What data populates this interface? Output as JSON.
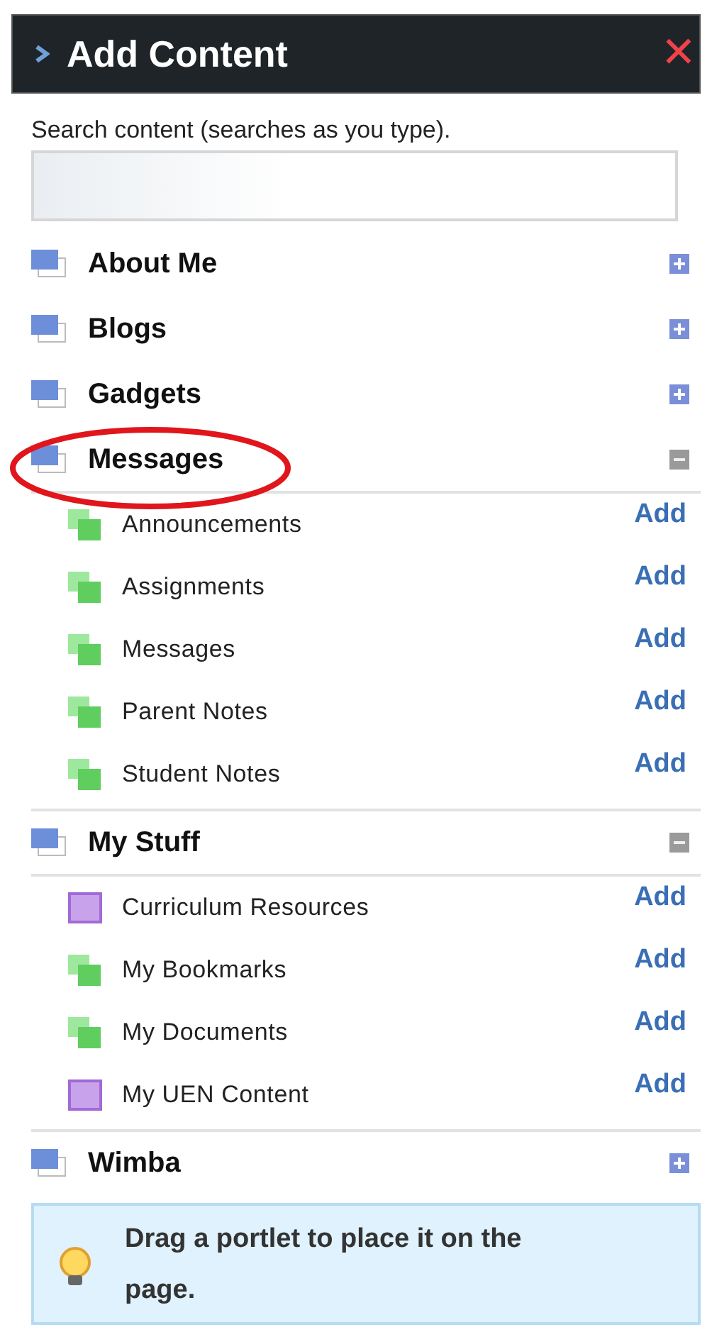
{
  "panel": {
    "title": "Add Content",
    "close_label": "✕"
  },
  "search": {
    "label": "Search content (searches as you type)."
  },
  "categories": [
    {
      "name": "About Me",
      "expanded": false,
      "circled": false
    },
    {
      "name": "Blogs",
      "expanded": false,
      "circled": false
    },
    {
      "name": "Gadgets",
      "expanded": false,
      "circled": false
    },
    {
      "name": "Messages",
      "expanded": true,
      "circled": true,
      "children": [
        {
          "name": "Announcements",
          "kind": "stack",
          "action": "Add"
        },
        {
          "name": "Assignments",
          "kind": "stack",
          "action": "Add"
        },
        {
          "name": "Messages",
          "kind": "stack",
          "action": "Add"
        },
        {
          "name": "Parent Notes",
          "kind": "stack",
          "action": "Add"
        },
        {
          "name": "Student Notes",
          "kind": "stack",
          "action": "Add"
        }
      ]
    },
    {
      "name": "My Stuff",
      "expanded": true,
      "circled": false,
      "children": [
        {
          "name": "Curriculum Resources",
          "kind": "single",
          "action": "Add"
        },
        {
          "name": "My Bookmarks",
          "kind": "stack",
          "action": "Add"
        },
        {
          "name": "My Documents",
          "kind": "stack",
          "action": "Add"
        },
        {
          "name": "My UEN Content",
          "kind": "single",
          "action": "Add"
        }
      ]
    },
    {
      "name": "Wimba",
      "expanded": false,
      "circled": false
    }
  ],
  "hint": {
    "text": "Drag a portlet to place it on the page."
  }
}
